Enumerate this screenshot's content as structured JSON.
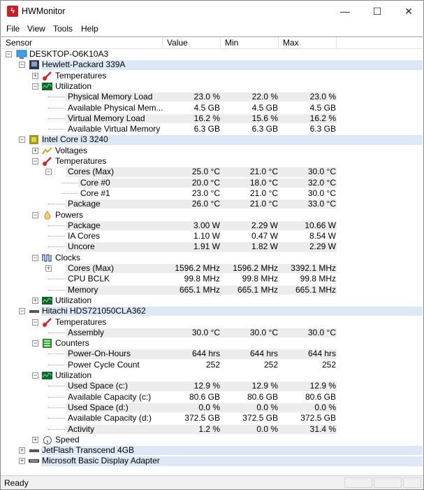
{
  "window": {
    "title": "HWMonitor",
    "icon": "lightning-icon",
    "minimize": "—",
    "maximize": "☐",
    "close": "✕"
  },
  "menu": [
    "File",
    "View",
    "Tools",
    "Help"
  ],
  "columns": [
    "Sensor",
    "Value",
    "Min",
    "Max"
  ],
  "rows": [
    {
      "lvl": 0,
      "exp": "-",
      "icon": "computer",
      "label": "DESKTOP-O6K10A3"
    },
    {
      "lvl": 1,
      "exp": "-",
      "icon": "motherboard",
      "label": "Hewlett-Packard 339A",
      "dev": true
    },
    {
      "lvl": 2,
      "exp": "+",
      "icon": "thermometer",
      "label": "Temperatures"
    },
    {
      "lvl": 2,
      "exp": "-",
      "icon": "utilization",
      "label": "Utilization"
    },
    {
      "lvl": 3,
      "label": "Physical Memory Load",
      "value": "23.0 %",
      "min": "22.0 %",
      "max": "23.0 %"
    },
    {
      "lvl": 3,
      "label": "Available Physical Mem...",
      "value": "4.5 GB",
      "min": "4.5 GB",
      "max": "4.5 GB"
    },
    {
      "lvl": 3,
      "label": "Virtual Memory Load",
      "value": "16.2 %",
      "min": "15.6 %",
      "max": "16.2 %"
    },
    {
      "lvl": 3,
      "label": "Available Virtual Memory",
      "value": "6.3 GB",
      "min": "6.3 GB",
      "max": "6.3 GB"
    },
    {
      "lvl": 1,
      "exp": "-",
      "icon": "cpu",
      "label": "Intel Core i3 3240",
      "dev": true
    },
    {
      "lvl": 2,
      "exp": "+",
      "icon": "voltage",
      "label": "Voltages"
    },
    {
      "lvl": 2,
      "exp": "-",
      "icon": "thermometer",
      "label": "Temperatures"
    },
    {
      "lvl": 3,
      "exp": "-",
      "label": "Cores (Max)",
      "value": "25.0 °C",
      "min": "21.0 °C",
      "max": "30.0 °C"
    },
    {
      "lvl": 4,
      "label": "Core #0",
      "value": "20.0 °C",
      "min": "18.0 °C",
      "max": "32.0 °C"
    },
    {
      "lvl": 4,
      "label": "Core #1",
      "value": "23.0 °C",
      "min": "21.0 °C",
      "max": "30.0 °C"
    },
    {
      "lvl": 3,
      "label": "Package",
      "value": "26.0 °C",
      "min": "21.0 °C",
      "max": "33.0 °C"
    },
    {
      "lvl": 2,
      "exp": "-",
      "icon": "power",
      "label": "Powers"
    },
    {
      "lvl": 3,
      "label": "Package",
      "value": "3.00 W",
      "min": "2.29 W",
      "max": "10.66 W"
    },
    {
      "lvl": 3,
      "label": "IA Cores",
      "value": "1.10 W",
      "min": "0.47 W",
      "max": "8.54 W"
    },
    {
      "lvl": 3,
      "label": "Uncore",
      "value": "1.91 W",
      "min": "1.82 W",
      "max": "2.29 W"
    },
    {
      "lvl": 2,
      "exp": "-",
      "icon": "clock",
      "label": "Clocks"
    },
    {
      "lvl": 3,
      "exp": "+",
      "label": "Cores (Max)",
      "value": "1596.2 MHz",
      "min": "1596.2 MHz",
      "max": "3392.1 MHz"
    },
    {
      "lvl": 3,
      "label": "CPU BCLK",
      "value": "99.8 MHz",
      "min": "99.8 MHz",
      "max": "99.8 MHz"
    },
    {
      "lvl": 3,
      "label": "Memory",
      "value": "665.1 MHz",
      "min": "665.1 MHz",
      "max": "665.1 MHz"
    },
    {
      "lvl": 2,
      "exp": "+",
      "icon": "utilization",
      "label": "Utilization"
    },
    {
      "lvl": 1,
      "exp": "-",
      "icon": "drive",
      "label": "Hitachi HDS721050CLA362",
      "dev": true
    },
    {
      "lvl": 2,
      "exp": "-",
      "icon": "thermometer",
      "label": "Temperatures"
    },
    {
      "lvl": 3,
      "label": "Assembly",
      "value": "30.0 °C",
      "min": "30.0 °C",
      "max": "30.0 °C"
    },
    {
      "lvl": 2,
      "exp": "-",
      "icon": "counter",
      "label": "Counters"
    },
    {
      "lvl": 3,
      "label": "Power-On-Hours",
      "value": "644 hrs",
      "min": "644 hrs",
      "max": "644 hrs"
    },
    {
      "lvl": 3,
      "label": "Power Cycle Count",
      "value": "252",
      "min": "252",
      "max": "252"
    },
    {
      "lvl": 2,
      "exp": "-",
      "icon": "utilization",
      "label": "Utilization"
    },
    {
      "lvl": 3,
      "label": "Used Space (c:)",
      "value": "12.9 %",
      "min": "12.9 %",
      "max": "12.9 %"
    },
    {
      "lvl": 3,
      "label": "Available Capacity (c:)",
      "value": "80.6 GB",
      "min": "80.6 GB",
      "max": "80.6 GB"
    },
    {
      "lvl": 3,
      "label": "Used Space (d:)",
      "value": "0.0 %",
      "min": "0.0 %",
      "max": "0.0 %"
    },
    {
      "lvl": 3,
      "label": "Available Capacity (d:)",
      "value": "372.5 GB",
      "min": "372.5 GB",
      "max": "372.5 GB"
    },
    {
      "lvl": 3,
      "label": "Activity",
      "value": "1.2 %",
      "min": "0.0 %",
      "max": "31.4 %"
    },
    {
      "lvl": 2,
      "exp": "+",
      "icon": "speed",
      "label": "Speed"
    },
    {
      "lvl": 1,
      "exp": "+",
      "icon": "drive",
      "label": "JetFlash Transcend 4GB",
      "dev": true
    },
    {
      "lvl": 1,
      "exp": "+",
      "icon": "display",
      "label": "Microsoft Basic Display Adapter",
      "dev": true
    }
  ],
  "status": {
    "text": "Ready"
  }
}
